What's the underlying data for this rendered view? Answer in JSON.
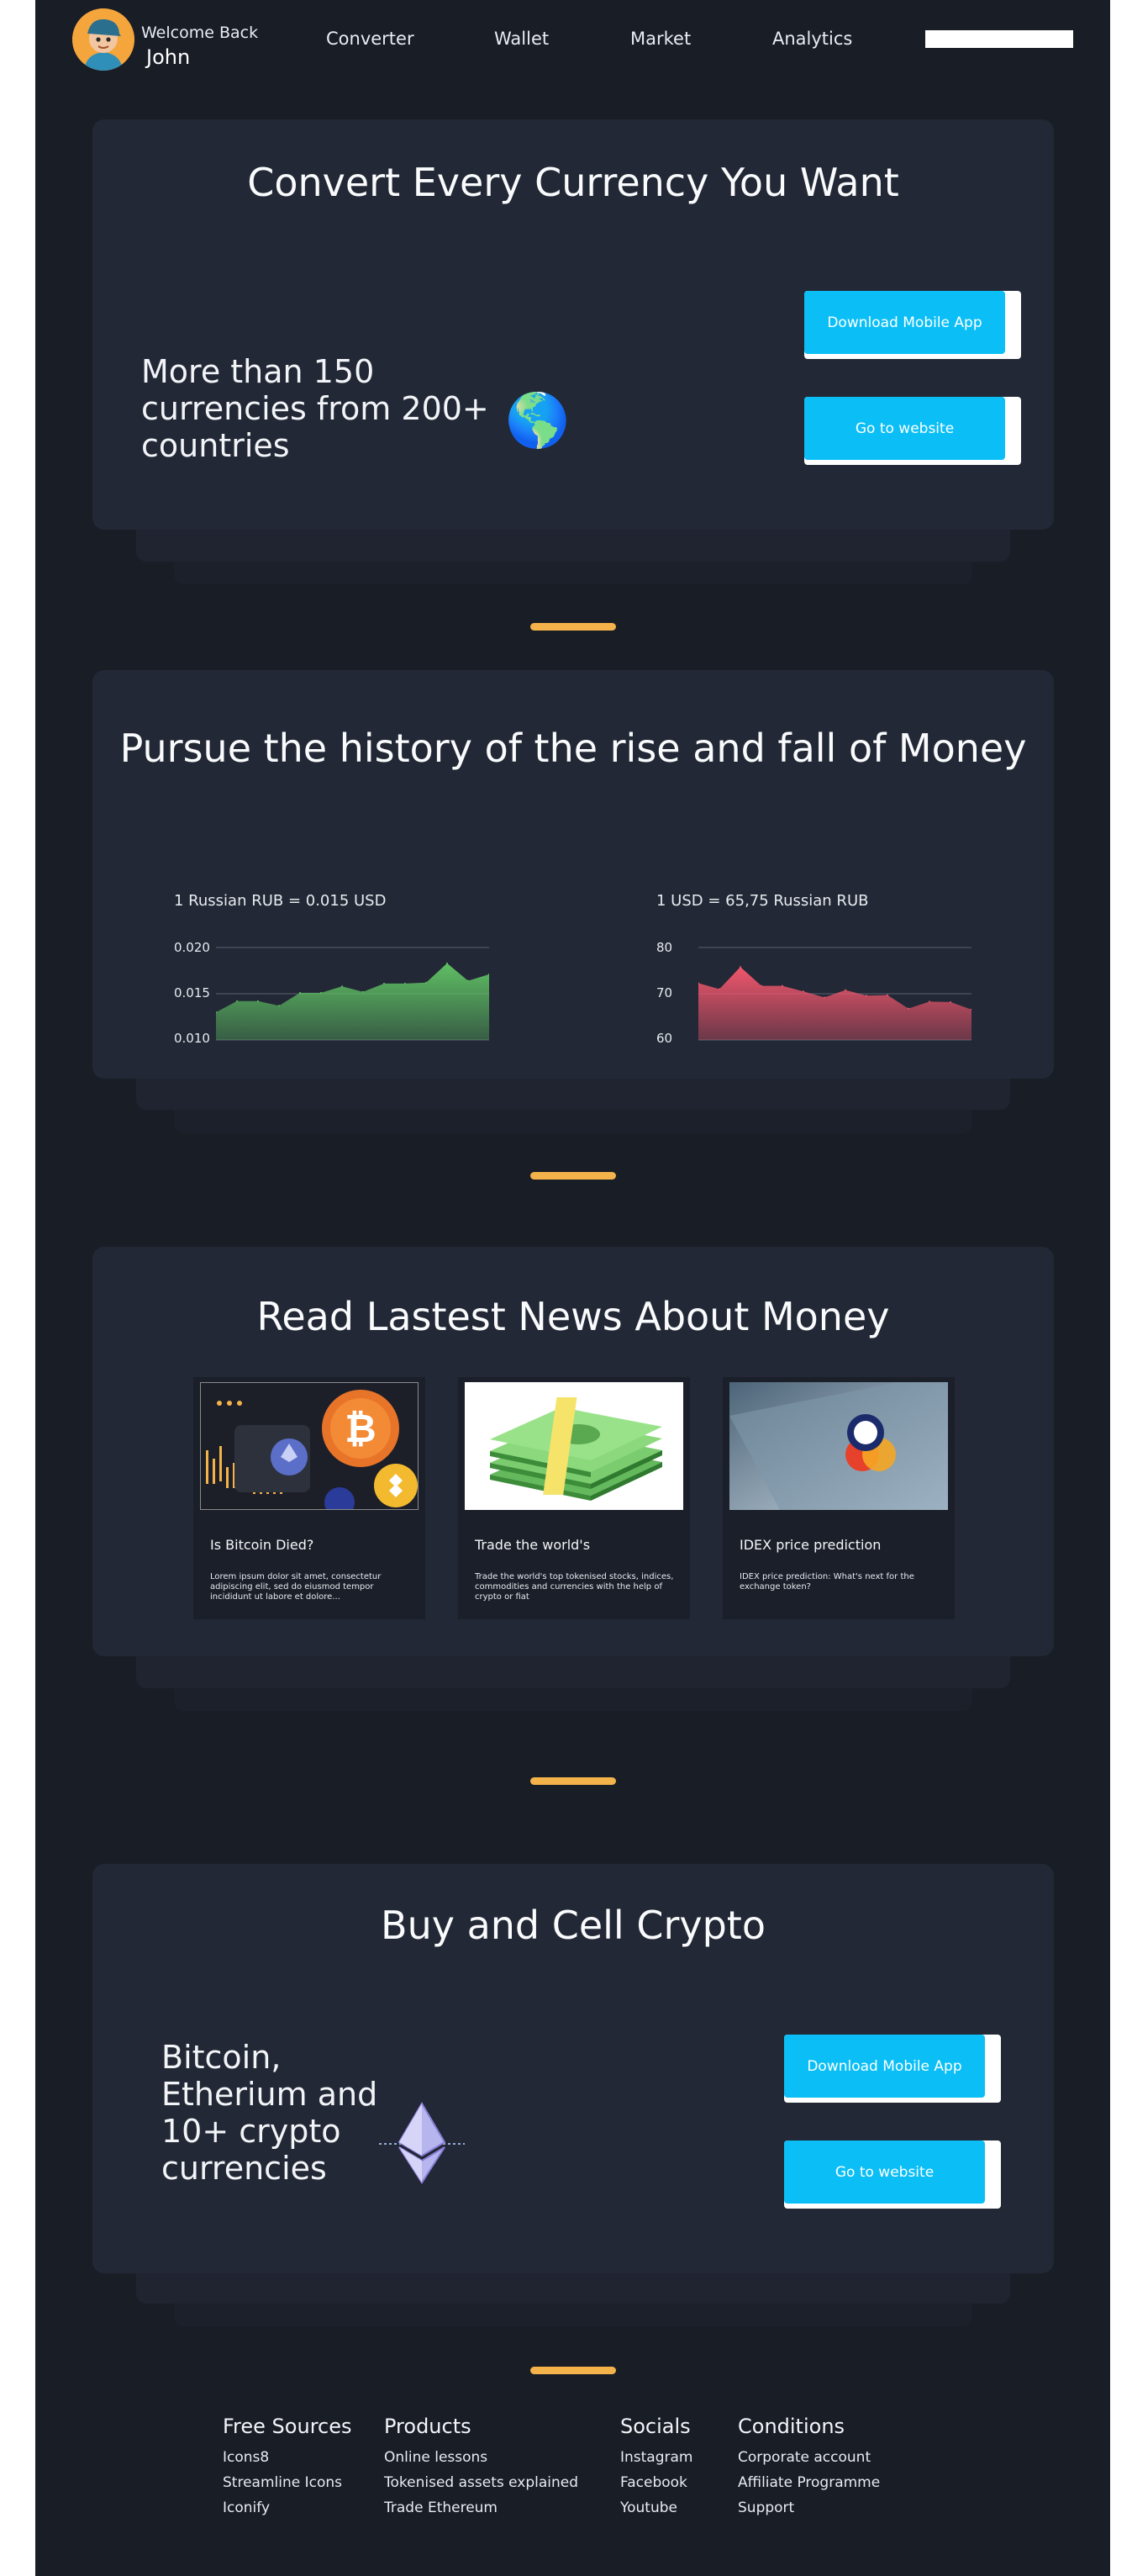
{
  "header": {
    "welcome": "Welcome Back",
    "user_name": "John",
    "nav": [
      "Converter",
      "Wallet",
      "Market",
      "Analytics"
    ]
  },
  "converter": {
    "title": "Convert Every Currency You Want",
    "text_lines": [
      "More than 150",
      "currencies from 200+",
      "countries"
    ],
    "globe_icon": "🌎",
    "download_label": "Download Mobile App",
    "website_label": "Go to website"
  },
  "history": {
    "title": "Pursue the history of the rise and fall of Money"
  },
  "news": {
    "title": "Read Lastest News About Money",
    "items": [
      {
        "title": "Is Bitcoin Died?",
        "desc": "Lorem ipsum dolor sit amet, consectetur adipiscing elit, sed do eiusmod tempor incididunt ut labore et dolore..."
      },
      {
        "title": "Trade the world's",
        "desc": "Trade the world's top tokenised stocks, indices, commodities and currencies with the help of crypto or fiat"
      },
      {
        "title": "IDEX price prediction",
        "desc": "IDEX price prediction: What's next for the exchange token?"
      }
    ]
  },
  "crypto": {
    "title": "Buy and Cell Crypto",
    "text_lines": [
      "Bitcoin,",
      "Etherium and",
      "10+ crypto",
      "currencies"
    ],
    "download_label": "Download Mobile App",
    "website_label": "Go to website"
  },
  "footer": {
    "columns": [
      {
        "heading": "Free Sources",
        "links": [
          "Icons8",
          "Streamline Icons",
          "Iconify"
        ]
      },
      {
        "heading": "Products",
        "links": [
          "Online lessons",
          "Tokenised assets explained",
          "Trade Ethereum"
        ]
      },
      {
        "heading": "Socials",
        "links": [
          "Instagram",
          "Facebook",
          "Youtube"
        ]
      },
      {
        "heading": "Conditions",
        "links": [
          "Corporate account",
          "Affiliate Programme",
          "Support"
        ]
      }
    ]
  },
  "colors": {
    "accent": "#0bbff6",
    "divider": "#f4b24a",
    "up": "#5fbf63",
    "down": "#f0566c"
  },
  "chart_data": [
    {
      "type": "area",
      "title": "1 Russian RUB = 0.015 USD",
      "ylim": [
        0.01,
        0.02
      ],
      "yticks": [
        "0.020",
        "0.015",
        "0.010"
      ],
      "y_tick_values": [
        0.02,
        0.015,
        0.01
      ],
      "x": [
        0,
        1,
        2,
        3,
        4,
        5,
        6,
        7,
        8,
        9,
        10,
        11,
        12,
        13
      ],
      "values": [
        0.013,
        0.0142,
        0.0142,
        0.0137,
        0.0151,
        0.0151,
        0.0158,
        0.0152,
        0.0161,
        0.0161,
        0.0162,
        0.0183,
        0.0164,
        0.0171
      ],
      "color": "#5fbf63"
    },
    {
      "type": "area",
      "title": "1 USD = 65,75 Russian RUB",
      "ylim": [
        60,
        80
      ],
      "yticks": [
        "80",
        "70",
        "60"
      ],
      "y_tick_values": [
        80,
        70,
        60
      ],
      "x": [
        0,
        1,
        2,
        3,
        4,
        5,
        6,
        7,
        8,
        9,
        10,
        11,
        12,
        13
      ],
      "values": [
        72.3,
        71.0,
        75.8,
        71.7,
        71.7,
        70.5,
        69.2,
        70.8,
        69.6,
        69.7,
        66.8,
        68.3,
        68.2,
        66.6
      ],
      "color": "#f0566c"
    }
  ]
}
